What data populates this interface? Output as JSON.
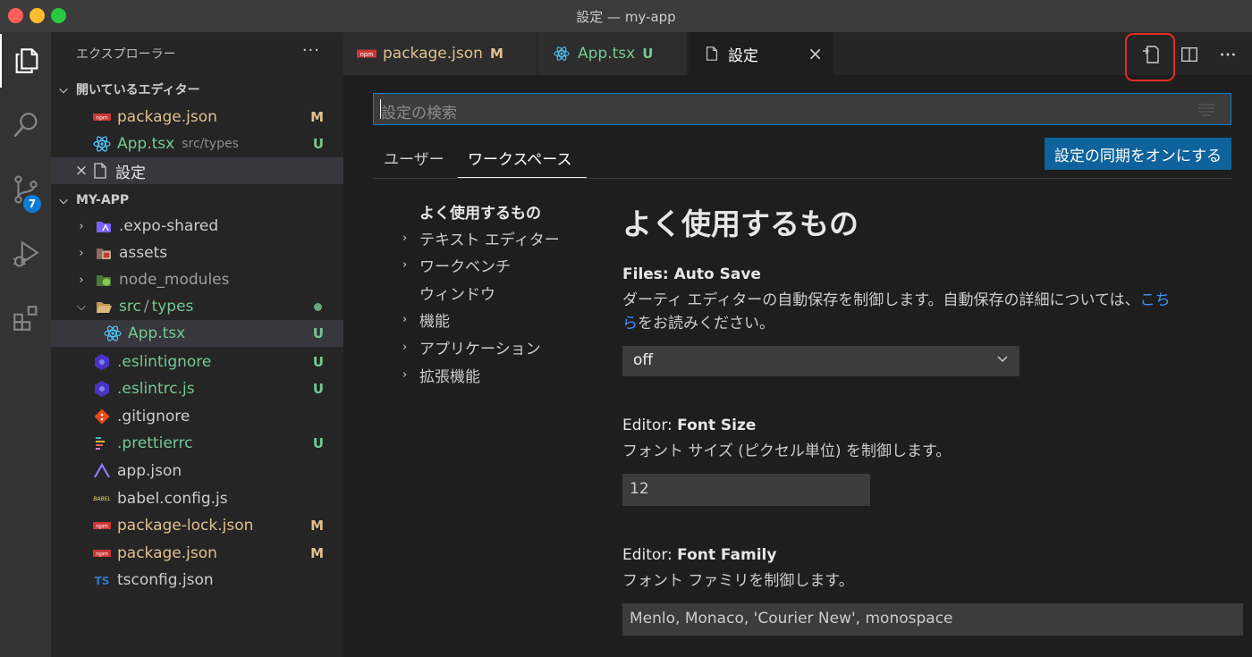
{
  "window": {
    "title": "設定 — my-app"
  },
  "activity_bar": {
    "items": [
      {
        "icon": "files-icon",
        "active": true
      },
      {
        "icon": "search-icon"
      },
      {
        "icon": "source-control-icon",
        "badge": "7"
      },
      {
        "icon": "run-debug-icon"
      },
      {
        "icon": "extensions-icon"
      }
    ]
  },
  "sidebar": {
    "header": "エクスプローラー",
    "more": "···",
    "open_editors": {
      "title": "開いているエディター",
      "items": [
        {
          "name": "package.json",
          "status": "M",
          "icon": "npm-icon"
        },
        {
          "name": "App.tsx",
          "desc": "src/types",
          "status": "U",
          "icon": "react-icon"
        },
        {
          "name": "設定",
          "icon": "file-icon",
          "close": "×"
        }
      ]
    },
    "project": {
      "title": "MY-APP",
      "items": [
        {
          "name": ".expo-shared",
          "icon": "expo-folder-icon"
        },
        {
          "name": "assets",
          "icon": "assets-folder-icon"
        },
        {
          "name": "node_modules",
          "icon": "node-folder-icon"
        },
        {
          "name": "src",
          "sep": "/",
          "name2": "types",
          "icon": "folder-open-icon"
        },
        {
          "name": "App.tsx",
          "status": "U",
          "icon": "react-icon"
        },
        {
          "name": ".eslintignore",
          "status": "U",
          "icon": "eslint-icon"
        },
        {
          "name": ".eslintrc.js",
          "status": "U",
          "icon": "eslint-icon"
        },
        {
          "name": ".gitignore",
          "icon": "git-icon"
        },
        {
          "name": ".prettierrc",
          "status": "U",
          "icon": "prettier-icon"
        },
        {
          "name": "app.json",
          "icon": "expo-icon"
        },
        {
          "name": "babel.config.js",
          "icon": "babel-icon"
        },
        {
          "name": "package-lock.json",
          "status": "M",
          "icon": "npm-icon"
        },
        {
          "name": "package.json",
          "status": "M",
          "icon": "npm-icon"
        },
        {
          "name": "tsconfig.json",
          "icon": "typescript-icon"
        }
      ]
    }
  },
  "tabs": [
    {
      "label": "package.json",
      "status": "M",
      "icon": "npm-icon"
    },
    {
      "label": "App.tsx",
      "status": "U",
      "icon": "react-icon"
    },
    {
      "label": "設定",
      "icon": "file-icon",
      "close": "×",
      "active": true
    }
  ],
  "tab_actions": [
    "open-settings-json-icon",
    "split-editor-icon",
    "more-actions-icon"
  ],
  "settings": {
    "search_placeholder": "設定の検索",
    "scopes": [
      "ユーザー",
      "ワークスペース"
    ],
    "sync_button": "設定の同期をオンにする",
    "toc": [
      {
        "label": "よく使用するもの"
      },
      {
        "label": "テキスト エディター"
      },
      {
        "label": "ワークベンチ"
      },
      {
        "label": "ウィンドウ"
      },
      {
        "label": "機能"
      },
      {
        "label": "アプリケーション"
      },
      {
        "label": "拡張機能"
      }
    ],
    "section_title": "よく使用するもの",
    "entries": [
      {
        "category": "Files: ",
        "key": "Auto Save",
        "desc_1": "ダーティ エディターの自動保存を制御します。自動保存の詳細については、",
        "link": "こち",
        "link_2": "ら",
        "desc_2": "をお読みください。",
        "value": "off"
      },
      {
        "category": "Editor: ",
        "key": "Font Size",
        "desc": "フォント サイズ (ピクセル単位) を制御します。",
        "value": "12"
      },
      {
        "category": "Editor: ",
        "key": "Font Family",
        "desc": "フォント ファミリを制御します。",
        "value": "Menlo, Monaco, 'Courier New', monospace"
      }
    ]
  }
}
